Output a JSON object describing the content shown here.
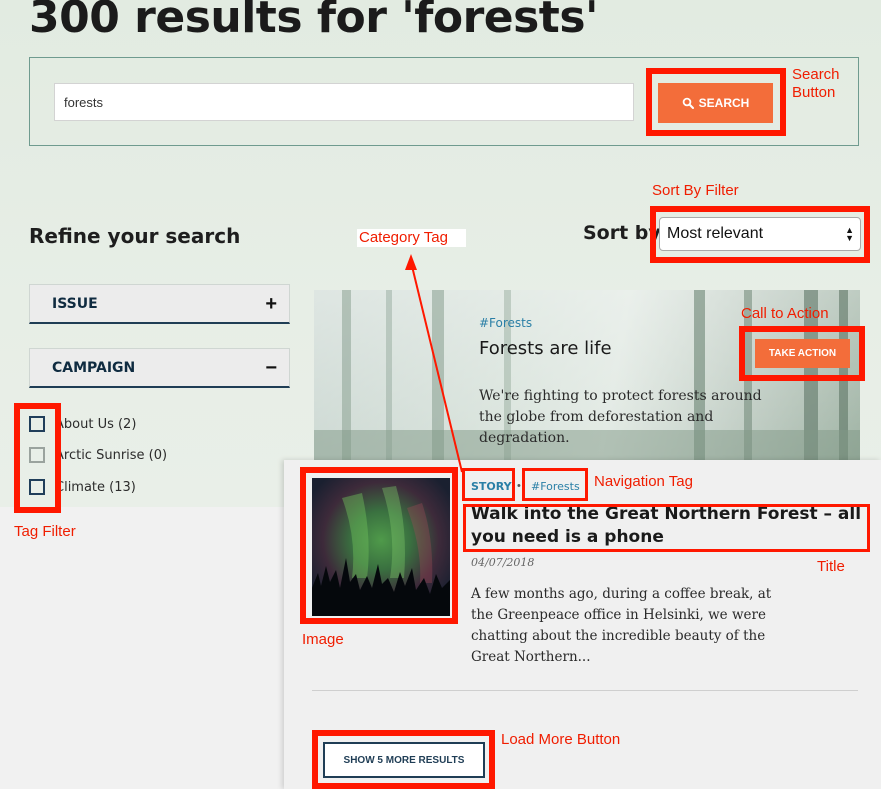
{
  "page": {
    "title": "300 results for 'forests'"
  },
  "search": {
    "value": "forests",
    "button_label": "SEARCH",
    "button_icon": "search-icon"
  },
  "refine": {
    "title": "Refine your search",
    "groups": [
      {
        "label": "ISSUE",
        "toggle": "+",
        "expanded": false
      },
      {
        "label": "CAMPAIGN",
        "toggle": "−",
        "expanded": true
      }
    ],
    "options": [
      {
        "label": "About Us (2)",
        "enabled": true
      },
      {
        "label": "Arctic Sunrise (0)",
        "enabled": false
      },
      {
        "label": "Climate (13)",
        "enabled": true
      }
    ]
  },
  "sort": {
    "label": "Sort by",
    "selected": "Most relevant"
  },
  "feature": {
    "tag": "#Forests",
    "title": "Forests are life",
    "description": "We're fighting to protect forests around the globe from deforestation and degradation.",
    "cta_label": "TAKE ACTION"
  },
  "result": {
    "type": "STORY",
    "separator": "•",
    "tag": "#Forests",
    "title": "Walk into the Great Northern Forest – all you need is a phone",
    "date": "04/07/2018",
    "excerpt": "A few months ago, during a coffee break, at the Greenpeace office in Helsinki, we were chatting about the incredible beauty of the Great Northern..."
  },
  "load_more": {
    "label": "SHOW 5 MORE RESULTS"
  },
  "annotations": {
    "search_button": "Search\nButton",
    "sort_filter": "Sort By Filter",
    "category_tag": "Category Tag",
    "call_to_action": "Call to Action",
    "navigation_tag": "Navigation Tag",
    "title": "Title",
    "image": "Image",
    "tag_filter": "Tag Filter",
    "load_more_button": "Load More Button"
  },
  "colors": {
    "accent": "#f36d3a",
    "link": "#2a7fa6",
    "navy": "#1f3d55",
    "annotation": "#ff1800"
  }
}
